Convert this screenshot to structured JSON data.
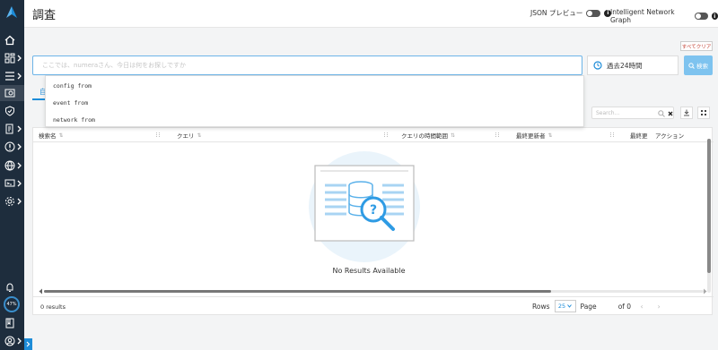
{
  "header": {
    "title": "調査",
    "json_preview_label": "JSON プレビュー",
    "network_graph_label": "Intelligent Network Graph"
  },
  "search": {
    "clear_label": "すべてクリア",
    "placeholder": "ここでは、numeraさん、今日は何をお探しですか",
    "time_range": "過去24時間",
    "search_button": "検索",
    "suggestions": [
      "config from",
      "event from",
      "network from"
    ]
  },
  "tabs": {
    "active_label": "自"
  },
  "table": {
    "search_placeholder": "Search...",
    "columns": [
      "検索名",
      "クエリ",
      "クエリの時間範囲",
      "最終更新者",
      "最終更",
      "アクション"
    ],
    "empty_message": "No Results Available",
    "results_count": "0 results"
  },
  "pagination": {
    "rows_label": "Rows",
    "rows_value": "25",
    "page_label": "Page",
    "page_total": "of 0"
  },
  "sidebar": {
    "progress_percent": 47,
    "progress_label": "47%",
    "items": [
      "home-icon",
      "dashboard-icon",
      "list-icon",
      "investigate-icon",
      "shield-icon",
      "compliance-icon",
      "alert-icon",
      "network-icon",
      "compute-icon",
      "settings-icon"
    ]
  },
  "colors": {
    "accent": "#1d8cd8",
    "sidebar": "#1e2d3d",
    "search_btn": "#7ec3ef",
    "clear_text": "#c0392b"
  }
}
